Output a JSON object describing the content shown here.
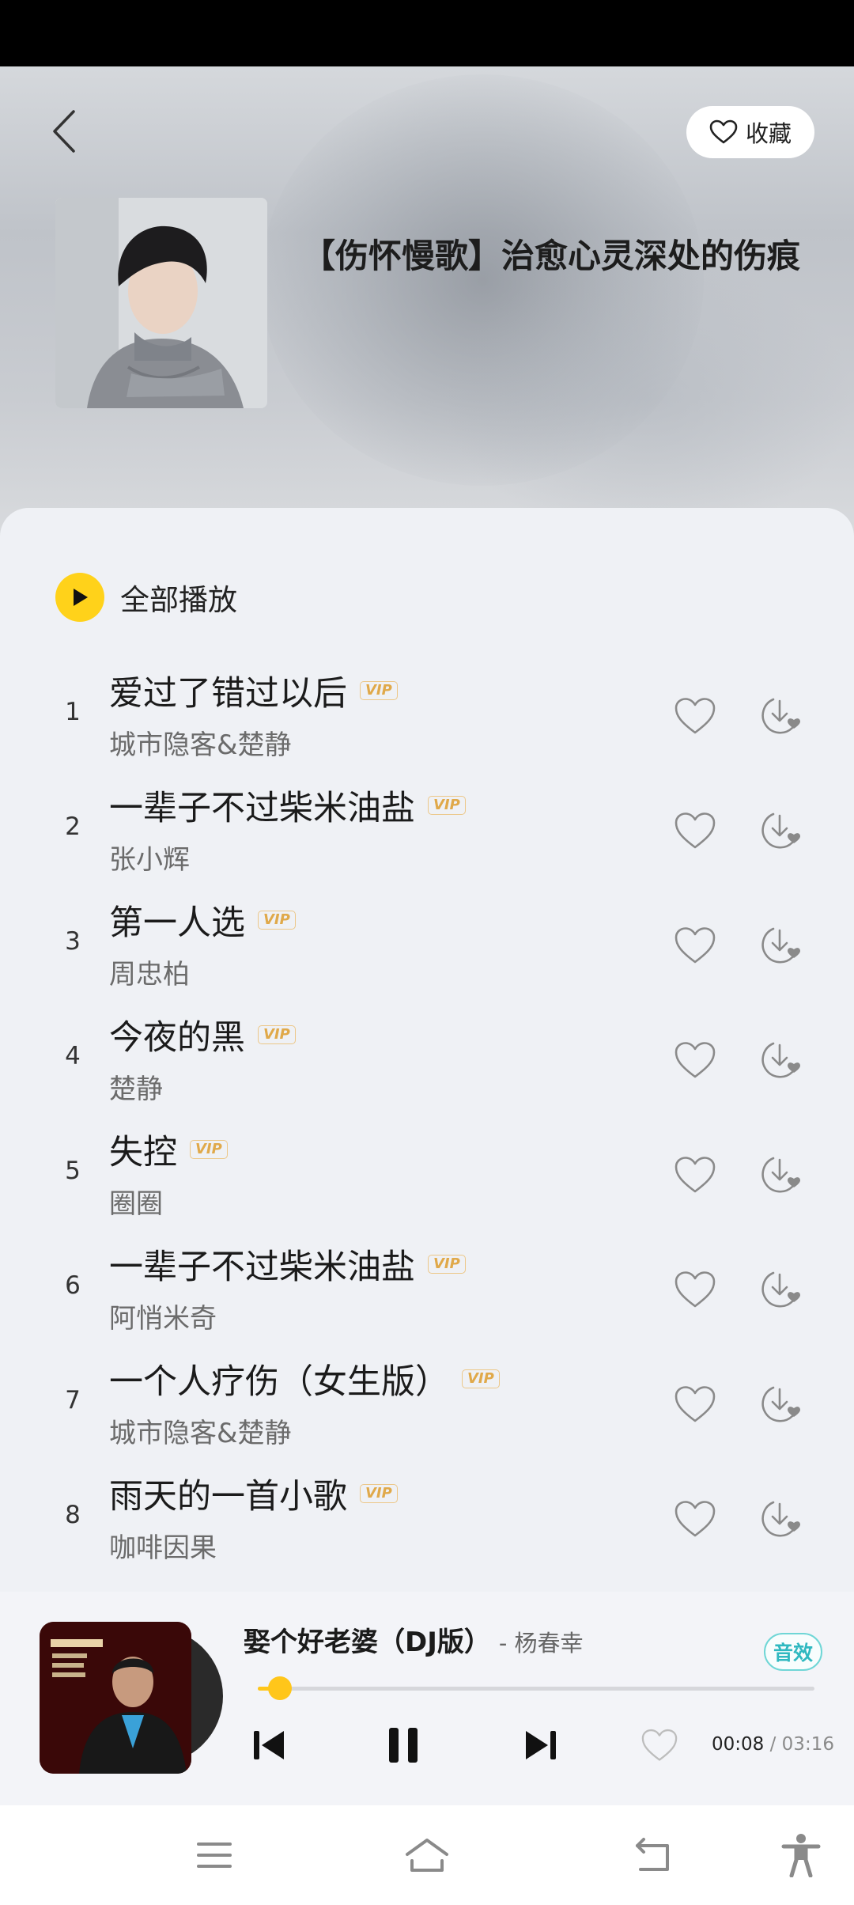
{
  "header": {
    "favorite_label": "收藏",
    "playlist_title": "【伤怀慢歌】治愈心灵深处的伤痕"
  },
  "list": {
    "play_all_label": "全部播放",
    "vip_label": "VIP",
    "songs": [
      {
        "index": "1",
        "title": "爱过了错过以后",
        "artist": "城市隐客&楚静"
      },
      {
        "index": "2",
        "title": "一辈子不过柴米油盐",
        "artist": "张小辉"
      },
      {
        "index": "3",
        "title": "第一人选",
        "artist": "周忠柏"
      },
      {
        "index": "4",
        "title": "今夜的黑",
        "artist": "楚静"
      },
      {
        "index": "5",
        "title": "失控",
        "artist": "圈圈"
      },
      {
        "index": "6",
        "title": "一辈子不过柴米油盐",
        "artist": "阿悄米奇"
      },
      {
        "index": "7",
        "title": "一个人疗伤（女生版）",
        "artist": "城市隐客&楚静"
      },
      {
        "index": "8",
        "title": "雨天的一首小歌",
        "artist": "咖啡因果"
      }
    ]
  },
  "player": {
    "title": "娶个好老婆（DJ版）",
    "artist": "- 杨春幸",
    "sound_effect_label": "音效",
    "current_time": "00:08",
    "separator": "/",
    "total_time": "03:16",
    "progress": 0.04,
    "state": "playing"
  },
  "colors": {
    "accent": "#ffc61a",
    "vip": "#e0a94a",
    "sound_effect": "#2fb8c0"
  }
}
